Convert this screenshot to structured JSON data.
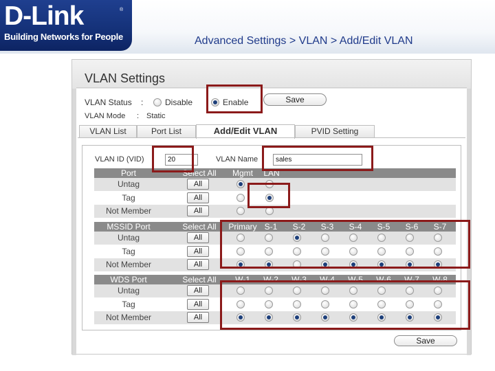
{
  "header": {
    "logo_name": "D-Link",
    "logo_reg": "®",
    "logo_tagline": "Building Networks for People",
    "breadcrumb": "Advanced Settings > VLAN > Add/Edit VLAN"
  },
  "panel": {
    "title": "VLAN Settings",
    "vlan_status_label": "VLAN Status",
    "vlan_status_colon": ":",
    "status_disable": "Disable",
    "status_enable": "Enable",
    "status_selected": "Enable",
    "save_label": "Save",
    "vlan_mode_label": "VLAN Mode",
    "vlan_mode_colon": ":",
    "vlan_mode_value": "Static"
  },
  "tabs": [
    {
      "label": "VLAN List",
      "active": false
    },
    {
      "label": "Port List",
      "active": false
    },
    {
      "label": "Add/Edit VLAN",
      "active": true
    },
    {
      "label": "PVID Setting",
      "active": false
    }
  ],
  "form": {
    "vlan_id_label": "VLAN ID (VID)",
    "vlan_id_value": "20",
    "vlan_name_label": "VLAN Name",
    "vlan_name_value": "sales",
    "bottom_save_label": "Save"
  },
  "row_labels": {
    "untag": "Untag",
    "tag": "Tag",
    "not_member": "Not Member"
  },
  "all_label": "All",
  "port_section": {
    "header": [
      "Port",
      "Select All",
      "Mgmt",
      "LAN"
    ],
    "selection": {
      "Mgmt": "Untag",
      "LAN": "Tag"
    }
  },
  "mssid_section": {
    "header": [
      "MSSID Port",
      "Select All",
      "Primary",
      "S-1",
      "S-2",
      "S-3",
      "S-4",
      "S-5",
      "S-6",
      "S-7"
    ],
    "selection": {
      "Primary": "Not Member",
      "S-1": "Not Member",
      "S-2": "Untag",
      "S-3": "Not Member",
      "S-4": "Not Member",
      "S-5": "Not Member",
      "S-6": "Not Member",
      "S-7": "Not Member"
    }
  },
  "wds_section": {
    "header": [
      "WDS Port",
      "Select All",
      "W-1",
      "W-2",
      "W-3",
      "W-4",
      "W-5",
      "W-6",
      "W-7",
      "W-8"
    ],
    "selection": {
      "W-1": "Not Member",
      "W-2": "Not Member",
      "W-3": "Not Member",
      "W-4": "Not Member",
      "W-5": "Not Member",
      "W-6": "Not Member",
      "W-7": "Not Member",
      "W-8": "Not Member"
    }
  },
  "colors": {
    "brand_blue": "#15327a",
    "highlight_red": "#8b1a1a",
    "table_header": "#8a8a8a"
  }
}
